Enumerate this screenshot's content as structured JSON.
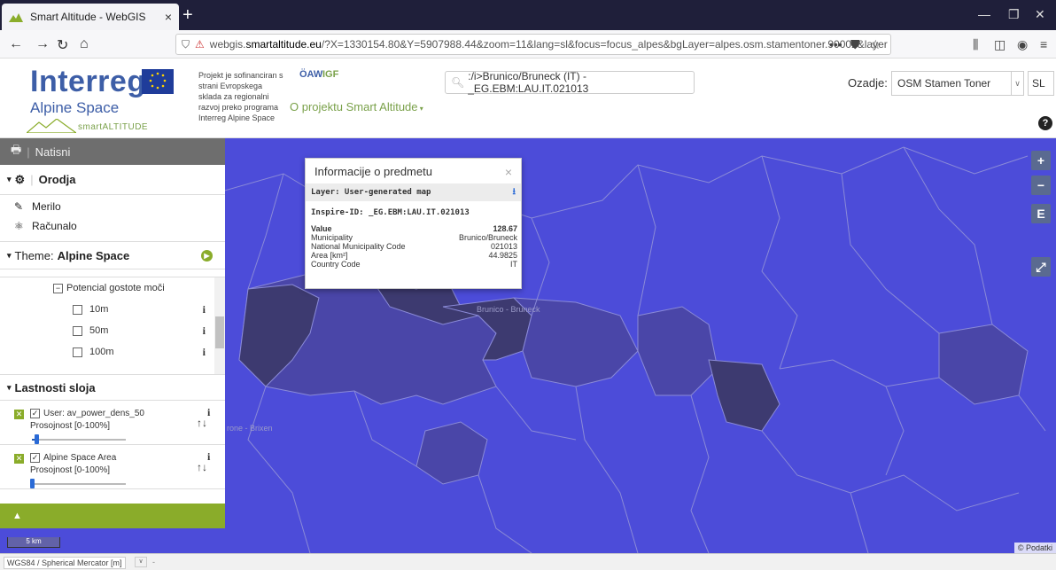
{
  "browser": {
    "tab_title": "Smart Altitude - WebGIS",
    "tab_close": "×",
    "new_tab": "+",
    "url_prefix": "webgis.",
    "url_domain": "smartaltitude.eu",
    "url_rest": "/?X=1330154.80&Y=5907988.44&zoom=11&lang=sl&focus=focus_alpes&bgLayer=alpes.osm.stamentoner.90002&layer",
    "url_more": "•••"
  },
  "header": {
    "logo_interreg": "Interreg",
    "logo_alpine": "Alpine Space",
    "logo_smart": "smartALTITUDE",
    "project_text": "Projekt je sofinanciran s strani Evropskega sklada za regionalni razvoj preko programa Interreg Alpine Space",
    "partner_oaw": "ÖAW",
    "partner_igf": "IGF",
    "about_menu": "O projektu Smart Altitude",
    "search_value": ":/i>Brunico/Bruneck (IT) - _EG.EBM:LAU.IT.021013",
    "background_label": "Ozadje:",
    "background_value": "OSM Stamen Toner",
    "language_value": "SL",
    "help": "?"
  },
  "panel": {
    "print": "Natisni",
    "tools_heading": "Orodja",
    "tool_ruler": "Merilo",
    "tool_calculator": "Računalo",
    "theme_label": "Theme:",
    "theme_value": "Alpine Space",
    "group_label": "Potencial gostote moči",
    "options": [
      "10m",
      "50m",
      "100m"
    ],
    "info_glyph": "i",
    "properties_heading": "Lastnosti sloja",
    "layers": [
      {
        "name": "User: av_power_dens_50",
        "opacity_label": "Prosojnost [0-100%]",
        "opacity": 0.05
      },
      {
        "name": "Alpine Space Area",
        "opacity_label": "Prosojnost [0-100%]",
        "opacity": 0.0
      }
    ]
  },
  "popup": {
    "title": "Informacije o predmetu",
    "close": "×",
    "layer": "Layer: User-generated map",
    "inspire_id": "Inspire-ID: _EG.EBM:LAU.IT.021013",
    "rows": [
      {
        "key": "Value",
        "value": "128.67"
      },
      {
        "key": "Municipality",
        "value": "Brunico/Bruneck"
      },
      {
        "key": "National Municipality Code",
        "value": "021013"
      },
      {
        "key": "Area [km²]",
        "value": "44.9825"
      },
      {
        "key": "Country Code",
        "value": "IT"
      }
    ]
  },
  "map": {
    "label_brunico": "Brunico - Bruneck",
    "label_brixen": "rone - Brixen",
    "zoom_in": "+",
    "zoom_out": "−",
    "e_button": "E",
    "expand": "⤢",
    "scale": "5 km",
    "attribution": "© Podatki",
    "colors": {
      "base": "#4c4cd9",
      "dark": "#3d3a70",
      "mid": "#4a46a8",
      "border": "#8a8ad8"
    }
  },
  "statusbar": {
    "crs": "WGS84 / Spherical Mercator [m]",
    "dash": "-"
  }
}
